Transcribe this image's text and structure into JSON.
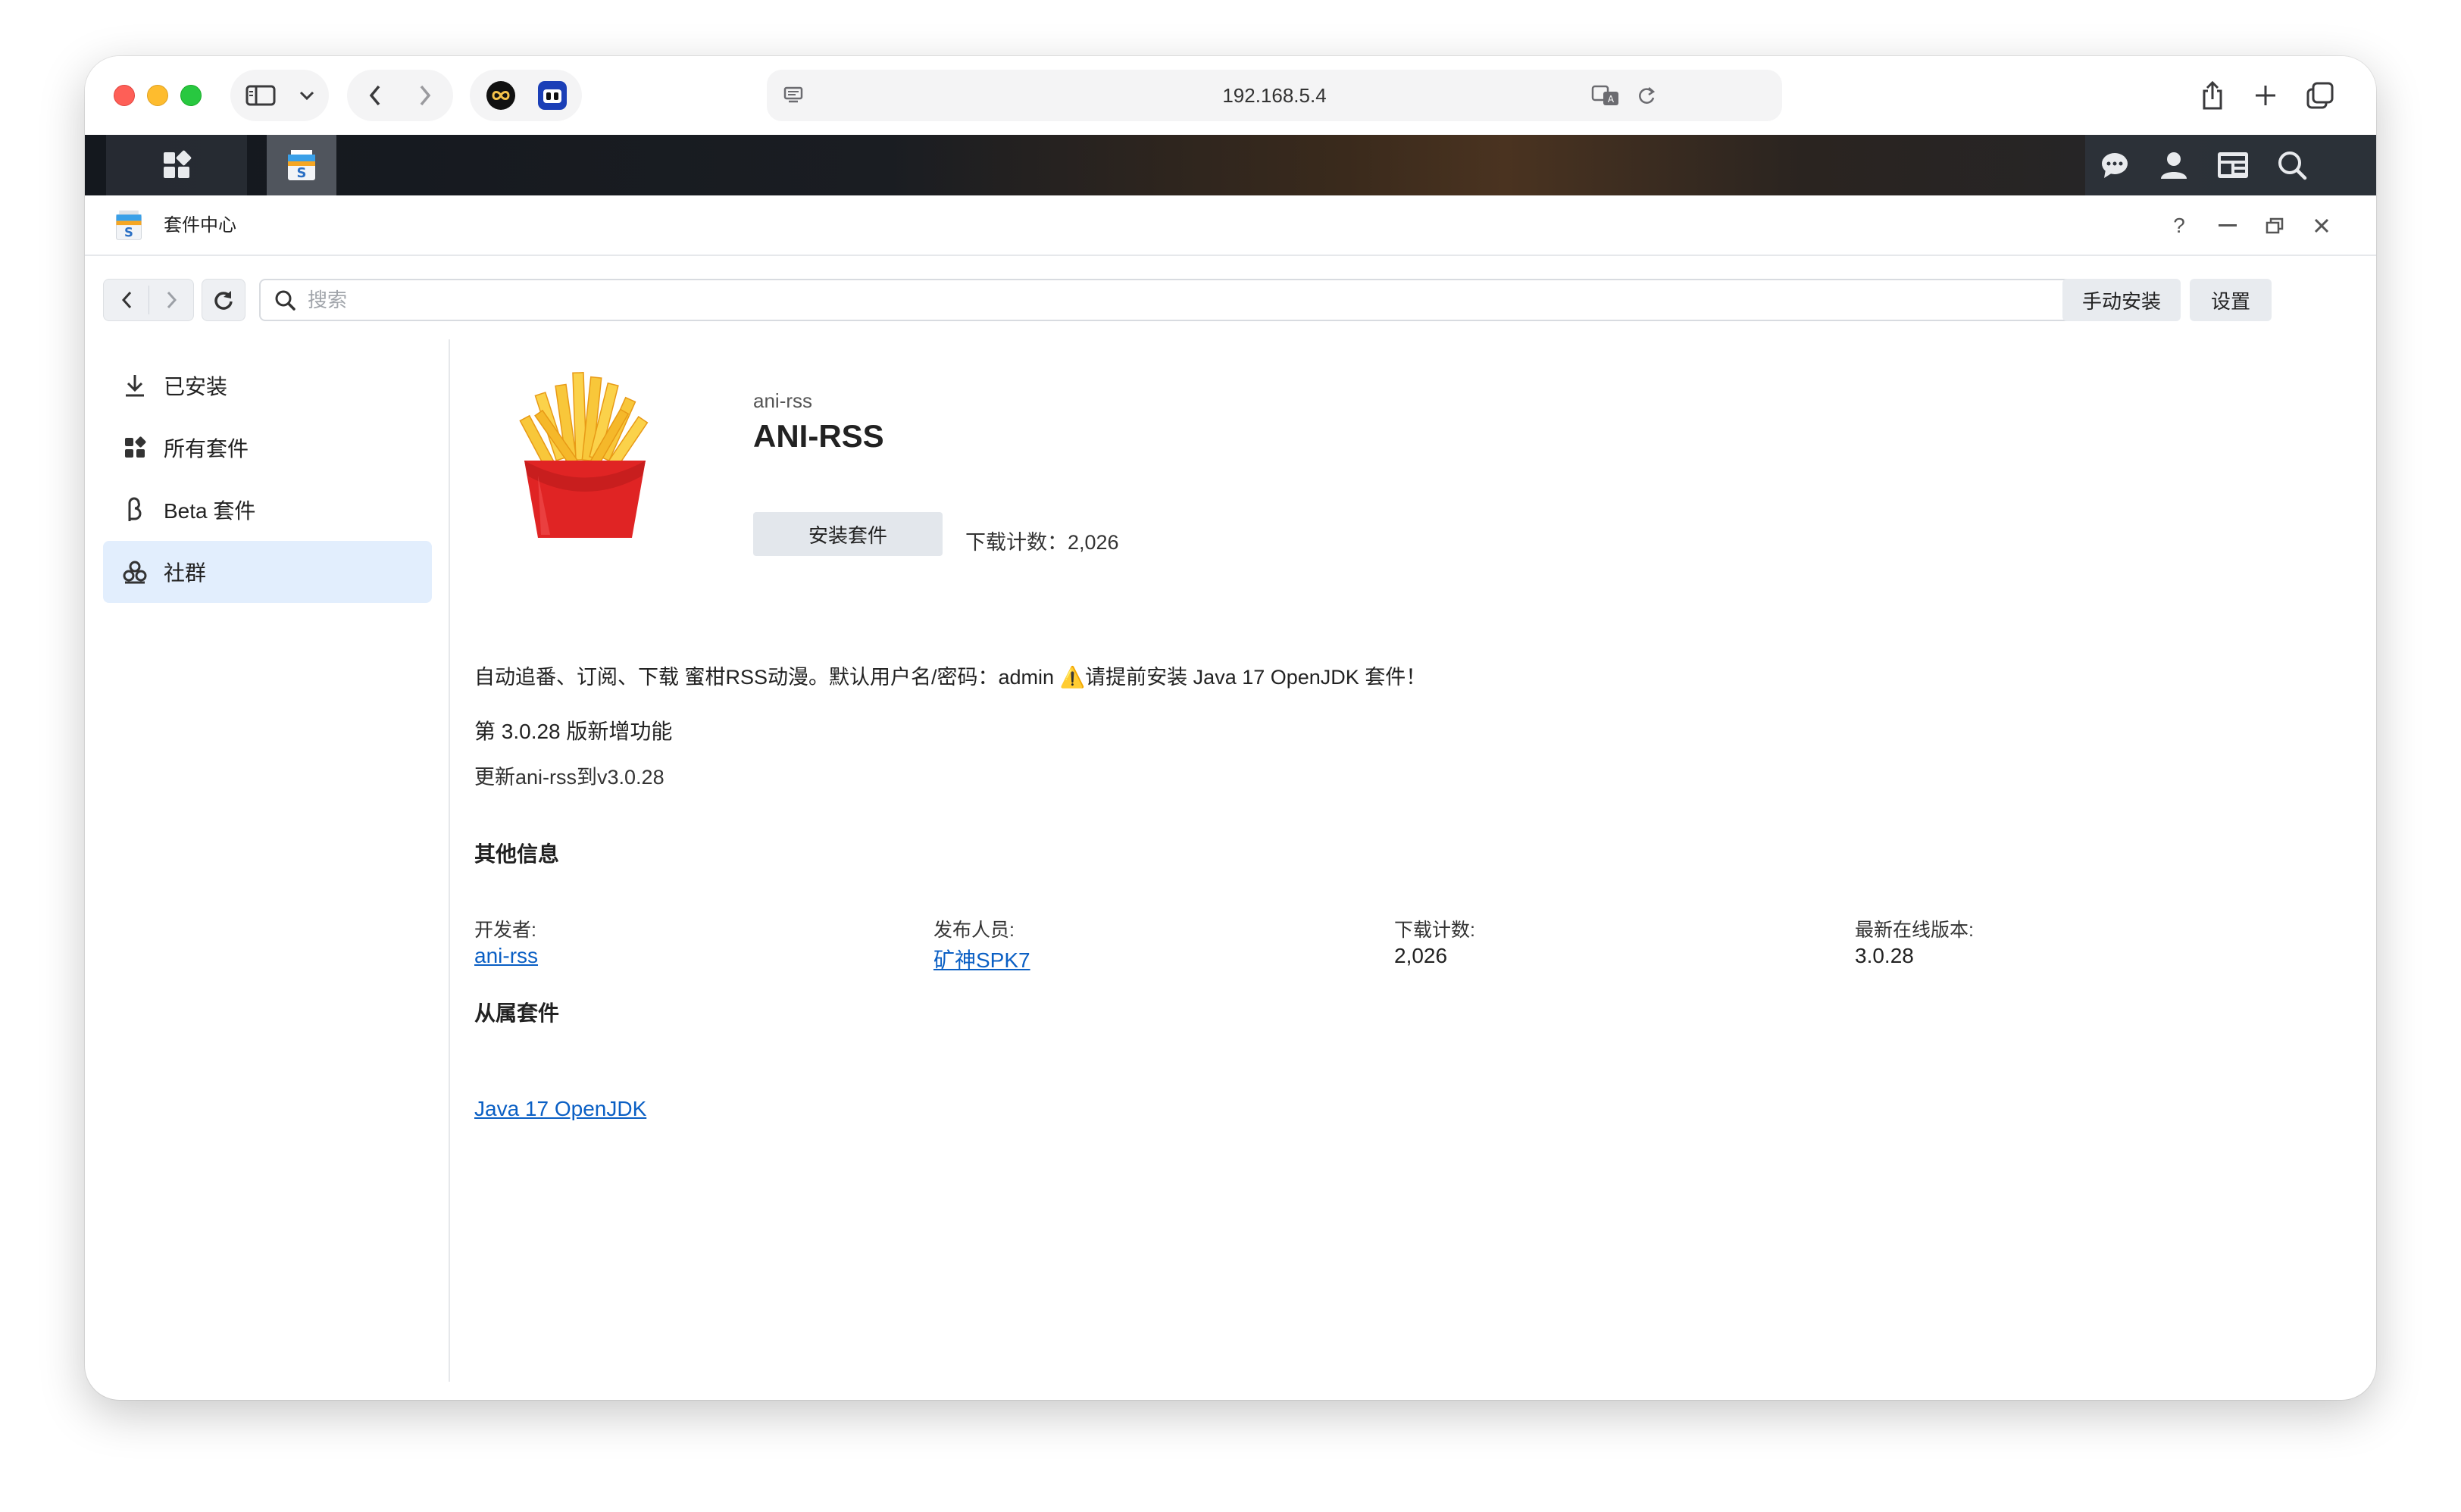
{
  "browser": {
    "address": "192.168.5.4"
  },
  "window": {
    "title": "套件中心"
  },
  "toolbar": {
    "search_placeholder": "搜索",
    "manual_install": "手动安装",
    "settings": "设置"
  },
  "sidebar": {
    "items": [
      {
        "label": "已安装",
        "icon": "download-icon"
      },
      {
        "label": "所有套件",
        "icon": "grid-icon"
      },
      {
        "label": "Beta 套件",
        "icon": "beta-icon"
      },
      {
        "label": "社群",
        "icon": "community-icon",
        "active": true
      }
    ]
  },
  "package": {
    "id": "ani-rss",
    "name": "ANI-RSS",
    "install_label": "安装套件",
    "download_count_text": "下载计数：2,026",
    "description": "自动追番、订阅、下载 蜜柑RSS动漫。默认用户名/密码：admin ⚠️请提前安装 Java 17 OpenJDK 套件！",
    "whats_new_title": "第 3.0.28 版新增功能",
    "whats_new_text": "更新ani-rss到v3.0.28",
    "other_info_title": "其他信息",
    "info": {
      "developer_label": "开发者:",
      "developer_value": "ani-rss",
      "publisher_label": "发布人员:",
      "publisher_value": "矿神SPK7",
      "downloads_label": "下载计数:",
      "downloads_value": "2,026",
      "latest_label": "最新在线版本:",
      "latest_value": "3.0.28"
    },
    "dependency_title": "从属套件",
    "dependency": "Java 17 OpenJDK"
  },
  "colors": {
    "accent_link": "#0a5fc4",
    "active_item_bg": "#e2eefd"
  }
}
